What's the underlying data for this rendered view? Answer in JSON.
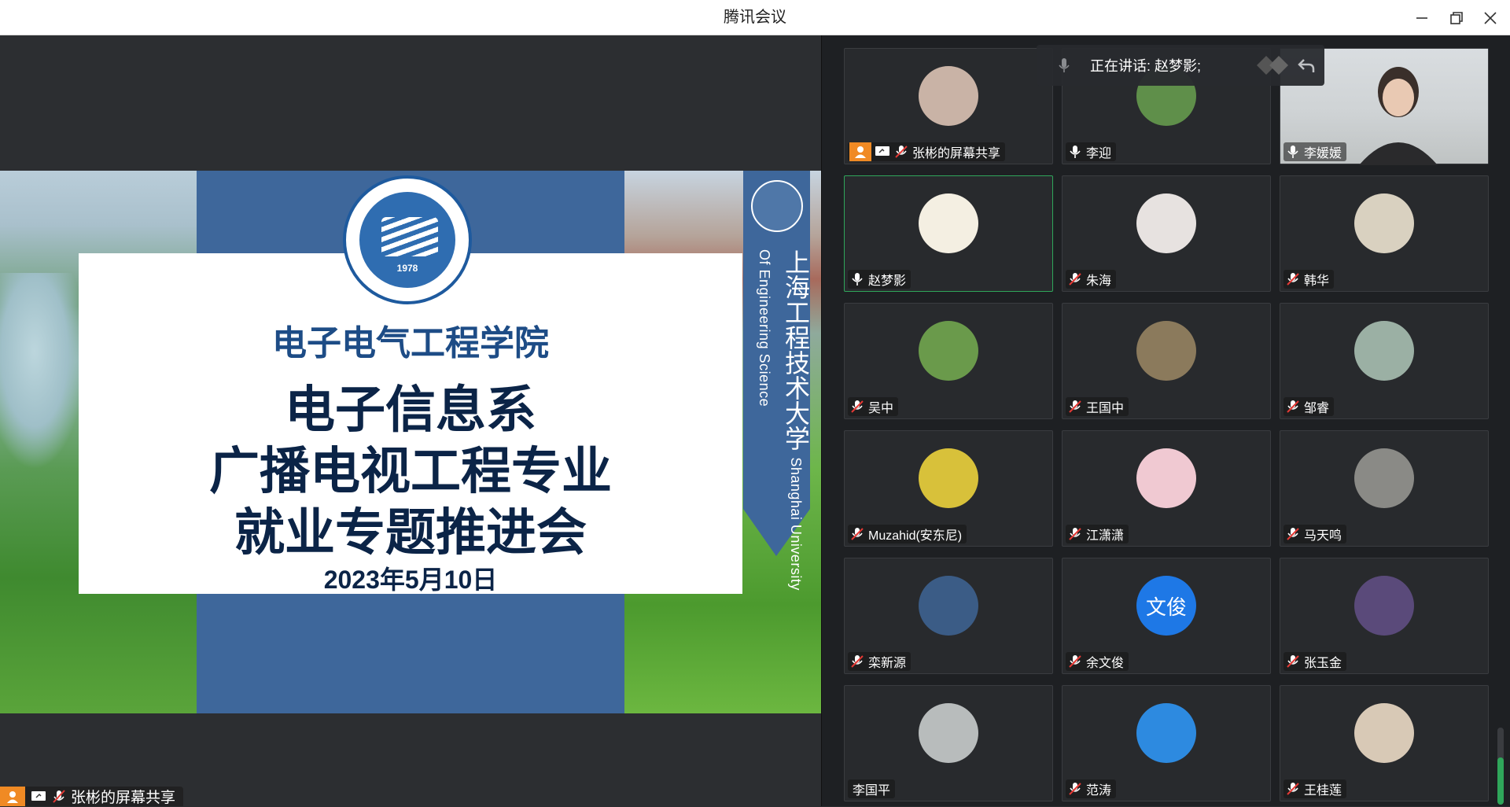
{
  "window": {
    "title": "腾讯会议"
  },
  "slide": {
    "school": "电子电气工程学院",
    "line1": "电子信息系",
    "line2": "广播电视工程专业",
    "line3": "就业专题推进会",
    "date": "2023年5月10日",
    "logo_year": "1978",
    "ribbon_cn": "上海工程技术大学",
    "ribbon_en": "Shanghai University Of Engineering Science"
  },
  "presenter": {
    "label": "张彬的屏幕共享"
  },
  "speaking": {
    "text": "正在讲话: 赵梦影;"
  },
  "participants": [
    {
      "name": "张彬的屏幕共享",
      "mic": "muted",
      "screen_share": true,
      "avatar_color": "#c9b3a6"
    },
    {
      "name": "李迎",
      "mic": "on",
      "avatar_color": "#5f8f4a"
    },
    {
      "name": "李媛媛",
      "mic": "on",
      "camera": true,
      "avatar_color": "#cfd3d5"
    },
    {
      "name": "赵梦影",
      "mic": "on",
      "active": true,
      "avatar_color": "#f4efe2"
    },
    {
      "name": "朱海",
      "mic": "muted",
      "avatar_color": "#e7e2e0"
    },
    {
      "name": "韩华",
      "mic": "muted",
      "avatar_color": "#d9d1c0"
    },
    {
      "name": "吴中",
      "mic": "muted",
      "avatar_color": "#6a9a4b"
    },
    {
      "name": "王国中",
      "mic": "muted",
      "avatar_color": "#8b7a5c"
    },
    {
      "name": "邹睿",
      "mic": "muted",
      "avatar_color": "#9bb0a4"
    },
    {
      "name": "Muzahid(安东尼)",
      "mic": "muted",
      "avatar_color": "#d8c13a"
    },
    {
      "name": "江潇潇",
      "mic": "muted",
      "avatar_color": "#f0c9d2"
    },
    {
      "name": "马天鸣",
      "mic": "muted",
      "avatar_color": "#8a8a86"
    },
    {
      "name": "栾新源",
      "mic": "muted",
      "avatar_color": "#3b5c86"
    },
    {
      "name": "余文俊",
      "mic": "muted",
      "avatar_color": "#1e78e6",
      "initials": "文俊"
    },
    {
      "name": "张玉金",
      "mic": "muted",
      "avatar_color": "#5a4a7a"
    },
    {
      "name": "李国平",
      "mic": "none",
      "avatar_color": "#b8bcbc"
    },
    {
      "name": "范涛",
      "mic": "muted",
      "avatar_color": "#2d8ae0"
    },
    {
      "name": "王桂莲",
      "mic": "muted",
      "avatar_color": "#d8c9b6"
    }
  ]
}
